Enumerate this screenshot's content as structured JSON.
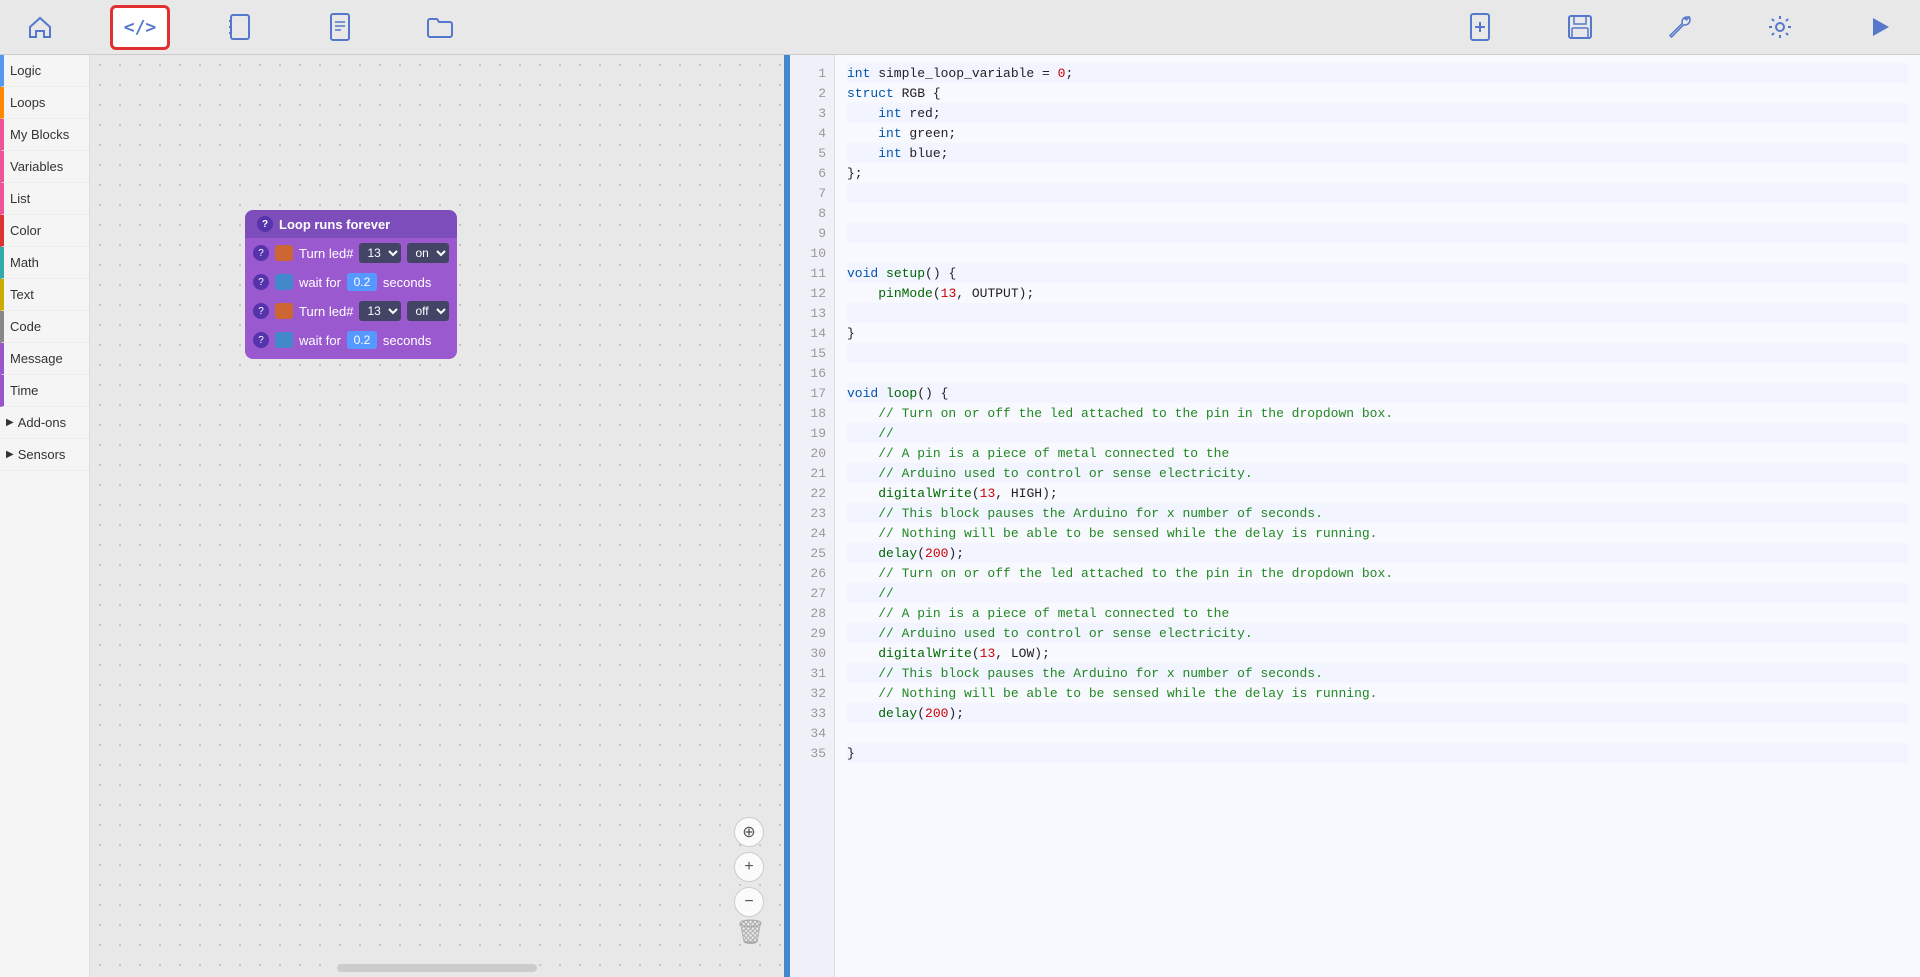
{
  "toolbar": {
    "buttons": [
      {
        "id": "home",
        "icon": "⌂",
        "label": "Home",
        "active": false
      },
      {
        "id": "code",
        "icon": "</>",
        "label": "Code",
        "active": true
      },
      {
        "id": "notebook",
        "icon": "📓",
        "label": "Notebook",
        "active": false
      },
      {
        "id": "document",
        "icon": "📄",
        "label": "Document",
        "active": false
      },
      {
        "id": "folder",
        "icon": "📁",
        "label": "Folder",
        "active": false
      },
      {
        "id": "new-doc",
        "icon": "🗒",
        "label": "New Document",
        "active": false,
        "right": true
      },
      {
        "id": "save",
        "icon": "💾",
        "label": "Save",
        "active": false,
        "right": true
      },
      {
        "id": "wrench",
        "icon": "🔧",
        "label": "Settings",
        "active": false,
        "right": true
      },
      {
        "id": "gear",
        "icon": "⚙",
        "label": "Preferences",
        "active": false,
        "right": true
      },
      {
        "id": "export",
        "icon": "➤",
        "label": "Export",
        "active": false,
        "right": true
      }
    ]
  },
  "sidebar": {
    "items": [
      {
        "id": "logic",
        "label": "Logic",
        "color": "blue",
        "expandable": false
      },
      {
        "id": "loops",
        "label": "Loops",
        "color": "orange",
        "expandable": false
      },
      {
        "id": "my-blocks",
        "label": "My Blocks",
        "color": "pink",
        "expandable": false
      },
      {
        "id": "variables",
        "label": "Variables",
        "color": "pink",
        "expandable": false
      },
      {
        "id": "list",
        "label": "List",
        "color": "pink",
        "expandable": false
      },
      {
        "id": "color",
        "label": "Color",
        "color": "red",
        "expandable": false
      },
      {
        "id": "math",
        "label": "Math",
        "color": "teal",
        "expandable": false
      },
      {
        "id": "text",
        "label": "Text",
        "color": "yellow",
        "expandable": false
      },
      {
        "id": "code",
        "label": "Code",
        "color": "gray",
        "expandable": false
      },
      {
        "id": "message",
        "label": "Message",
        "color": "purple",
        "expandable": false
      },
      {
        "id": "time",
        "label": "Time",
        "color": "purple",
        "expandable": false
      },
      {
        "id": "add-ons",
        "label": "Add-ons",
        "color": "",
        "expandable": true
      },
      {
        "id": "sensors",
        "label": "Sensors",
        "color": "",
        "expandable": true
      }
    ]
  },
  "blocks": {
    "header": "Loop runs forever",
    "rows": [
      {
        "type": "led",
        "text1": "Turn led#",
        "dropdown1": "13",
        "dropdown2": "on"
      },
      {
        "type": "wait",
        "text1": "wait for",
        "value": "0.2",
        "text2": "seconds"
      },
      {
        "type": "led",
        "text1": "Turn led#",
        "dropdown1": "13",
        "dropdown2": "off"
      },
      {
        "type": "wait",
        "text1": "wait for",
        "value": "0.2",
        "text2": "seconds"
      }
    ]
  },
  "code": {
    "lines": [
      {
        "num": 1,
        "tokens": [
          {
            "t": "type",
            "v": "int"
          },
          {
            "t": "plain",
            "v": " simple_loop_variable "
          },
          {
            "t": "plain",
            "v": "= "
          },
          {
            "t": "num",
            "v": "0"
          },
          {
            "t": "plain",
            "v": ";"
          }
        ]
      },
      {
        "num": 2,
        "tokens": [
          {
            "t": "type",
            "v": "struct"
          },
          {
            "t": "plain",
            "v": " RGB {"
          }
        ]
      },
      {
        "num": 3,
        "tokens": [
          {
            "t": "plain",
            "v": "    "
          },
          {
            "t": "type",
            "v": "int"
          },
          {
            "t": "plain",
            "v": " red;"
          }
        ]
      },
      {
        "num": 4,
        "tokens": [
          {
            "t": "plain",
            "v": "    "
          },
          {
            "t": "type",
            "v": "int"
          },
          {
            "t": "plain",
            "v": " green;"
          }
        ]
      },
      {
        "num": 5,
        "tokens": [
          {
            "t": "plain",
            "v": "    "
          },
          {
            "t": "type",
            "v": "int"
          },
          {
            "t": "plain",
            "v": " blue;"
          }
        ]
      },
      {
        "num": 6,
        "tokens": [
          {
            "t": "plain",
            "v": "};"
          }
        ]
      },
      {
        "num": 7,
        "tokens": []
      },
      {
        "num": 8,
        "tokens": []
      },
      {
        "num": 9,
        "tokens": []
      },
      {
        "num": 10,
        "tokens": []
      },
      {
        "num": 11,
        "tokens": [
          {
            "t": "type",
            "v": "void"
          },
          {
            "t": "plain",
            "v": " "
          },
          {
            "t": "func",
            "v": "setup"
          },
          {
            "t": "plain",
            "v": "() {"
          }
        ]
      },
      {
        "num": 12,
        "tokens": [
          {
            "t": "plain",
            "v": "    "
          },
          {
            "t": "func",
            "v": "pinMode"
          },
          {
            "t": "plain",
            "v": "("
          },
          {
            "t": "num",
            "v": "13"
          },
          {
            "t": "plain",
            "v": ", OUTPUT);"
          }
        ]
      },
      {
        "num": 13,
        "tokens": []
      },
      {
        "num": 14,
        "tokens": [
          {
            "t": "plain",
            "v": "}"
          }
        ]
      },
      {
        "num": 15,
        "tokens": []
      },
      {
        "num": 16,
        "tokens": []
      },
      {
        "num": 17,
        "tokens": [
          {
            "t": "type",
            "v": "void"
          },
          {
            "t": "plain",
            "v": " "
          },
          {
            "t": "func",
            "v": "loop"
          },
          {
            "t": "plain",
            "v": "() {"
          }
        ]
      },
      {
        "num": 18,
        "tokens": [
          {
            "t": "comment",
            "v": "    // Turn on or off the led attached to the pin in the dropdown box."
          }
        ]
      },
      {
        "num": 19,
        "tokens": [
          {
            "t": "comment",
            "v": "    //"
          }
        ]
      },
      {
        "num": 20,
        "tokens": [
          {
            "t": "comment",
            "v": "    // A pin is a piece of metal connected to the"
          }
        ]
      },
      {
        "num": 21,
        "tokens": [
          {
            "t": "comment",
            "v": "    // Arduino used to control or sense electricity."
          }
        ]
      },
      {
        "num": 22,
        "tokens": [
          {
            "t": "plain",
            "v": "    "
          },
          {
            "t": "func",
            "v": "digitalWrite"
          },
          {
            "t": "plain",
            "v": "("
          },
          {
            "t": "num",
            "v": "13"
          },
          {
            "t": "plain",
            "v": ", HIGH);"
          }
        ]
      },
      {
        "num": 23,
        "tokens": [
          {
            "t": "comment",
            "v": "    // This block pauses the Arduino for x number of seconds."
          }
        ]
      },
      {
        "num": 24,
        "tokens": [
          {
            "t": "comment",
            "v": "    // Nothing will be able to be sensed while the delay is running."
          }
        ]
      },
      {
        "num": 25,
        "tokens": [
          {
            "t": "plain",
            "v": "    "
          },
          {
            "t": "func",
            "v": "delay"
          },
          {
            "t": "plain",
            "v": "("
          },
          {
            "t": "num",
            "v": "200"
          },
          {
            "t": "plain",
            "v": ");"
          }
        ]
      },
      {
        "num": 26,
        "tokens": [
          {
            "t": "comment",
            "v": "    // Turn on or off the led attached to the pin in the dropdown box."
          }
        ]
      },
      {
        "num": 27,
        "tokens": [
          {
            "t": "comment",
            "v": "    //"
          }
        ]
      },
      {
        "num": 28,
        "tokens": [
          {
            "t": "comment",
            "v": "    // A pin is a piece of metal connected to the"
          }
        ]
      },
      {
        "num": 29,
        "tokens": [
          {
            "t": "comment",
            "v": "    // Arduino used to control or sense electricity."
          }
        ]
      },
      {
        "num": 30,
        "tokens": [
          {
            "t": "plain",
            "v": "    "
          },
          {
            "t": "func",
            "v": "digitalWrite"
          },
          {
            "t": "plain",
            "v": "("
          },
          {
            "t": "num",
            "v": "13"
          },
          {
            "t": "plain",
            "v": ", LOW);"
          }
        ]
      },
      {
        "num": 31,
        "tokens": [
          {
            "t": "comment",
            "v": "    // This block pauses the Arduino for x number of seconds."
          }
        ]
      },
      {
        "num": 32,
        "tokens": [
          {
            "t": "comment",
            "v": "    // Nothing will be able to be sensed while the delay is running."
          }
        ]
      },
      {
        "num": 33,
        "tokens": [
          {
            "t": "plain",
            "v": "    "
          },
          {
            "t": "func",
            "v": "delay"
          },
          {
            "t": "plain",
            "v": "("
          },
          {
            "t": "num",
            "v": "200"
          },
          {
            "t": "plain",
            "v": ");"
          }
        ]
      },
      {
        "num": 34,
        "tokens": []
      },
      {
        "num": 35,
        "tokens": [
          {
            "t": "plain",
            "v": "}"
          }
        ]
      }
    ]
  },
  "colors": {
    "accent": "#4488cc",
    "block_bg": "#9b59d0",
    "block_dark": "#7c4dbb"
  }
}
